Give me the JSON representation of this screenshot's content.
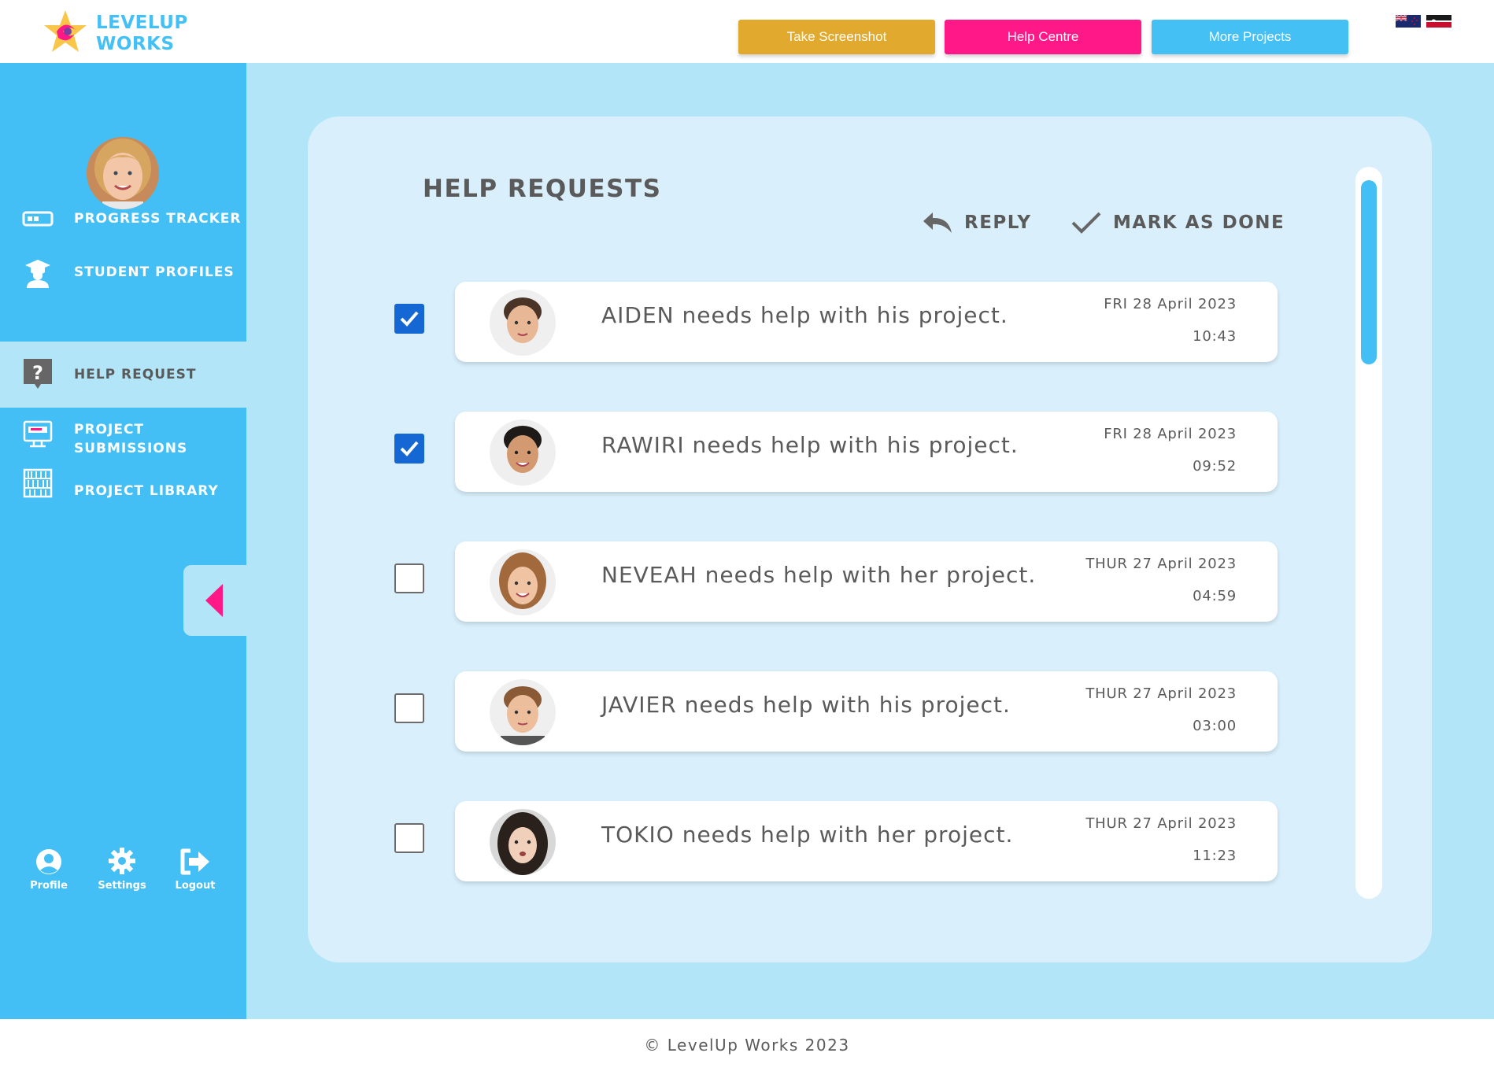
{
  "brand": {
    "logo_line1": "LEVELUP",
    "logo_line2": "WORKS"
  },
  "header": {
    "buttons": [
      {
        "label": "Take Screenshot",
        "color": "#e2a92f"
      },
      {
        "label": "Help Centre",
        "color": "#ff1887"
      },
      {
        "label": "More Projects",
        "color": "#45c0f5"
      }
    ],
    "languages": [
      "nz-flag-icon",
      "maori-flag-icon"
    ]
  },
  "sidebar": {
    "items": [
      {
        "label": "PROGRESS TRACKER",
        "icon": "progress-bar-icon",
        "active": false
      },
      {
        "label": "STUDENT PROFILES",
        "icon": "graduate-icon",
        "active": false
      },
      {
        "label": "HELP REQUEST",
        "icon": "question-bubble-icon",
        "active": true
      },
      {
        "label": "PROJECT SUBMISSIONS",
        "icon": "monitor-icon",
        "active": false
      },
      {
        "label": "PROJECT LIBRARY",
        "icon": "library-icon",
        "active": false
      }
    ],
    "bottom": [
      {
        "label": "Profile",
        "icon": "user-circle-icon"
      },
      {
        "label": "Settings",
        "icon": "gear-icon"
      },
      {
        "label": "Logout",
        "icon": "logout-icon"
      }
    ]
  },
  "main": {
    "title": "HELP REQUESTS",
    "actions": {
      "reply": "REPLY",
      "mark_done": "MARK AS DONE"
    },
    "requests": [
      {
        "message": "AIDEN needs help with his project.",
        "date": "FRI 28 April 2023",
        "time": "10:43",
        "checked": true
      },
      {
        "message": "RAWIRI needs help with his project.",
        "date": "FRI 28 April 2023",
        "time": "09:52",
        "checked": true
      },
      {
        "message": "NEVEAH needs help with her project.",
        "date": "THUR 27 April 2023",
        "time": "04:59",
        "checked": false
      },
      {
        "message": "JAVIER needs help with his project.",
        "date": "THUR 27 April 2023",
        "time": "03:00",
        "checked": false
      },
      {
        "message": "TOKIO needs help with her project.",
        "date": "THUR 27 April 2023",
        "time": "11:23",
        "checked": false
      }
    ]
  },
  "footer": {
    "text": "© LevelUp Works 2023"
  },
  "colors": {
    "accent": "#43bff5",
    "main_bg": "#b3e5f9",
    "panel_bg": "#d9f0fc",
    "checkbox": "#1567d3",
    "pink": "#ff1887"
  }
}
